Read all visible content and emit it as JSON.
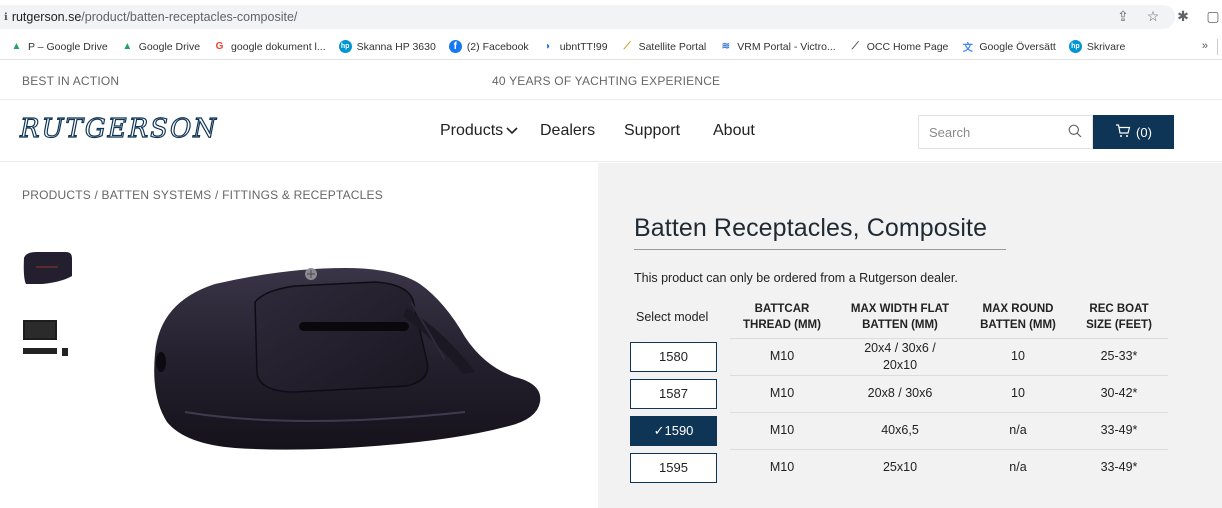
{
  "browser": {
    "url_domain": "rutgerson.se",
    "url_path": "/product/batten-receptacles-composite/",
    "bookmarks": [
      {
        "label": "P – Google Drive",
        "icon": "google-drive-icon",
        "color": "#1fa463"
      },
      {
        "label": "Google Drive",
        "icon": "google-drive-icon",
        "color": "#1fa463"
      },
      {
        "label": "google dokument l...",
        "icon": "google-g-icon",
        "color": "#ea4335"
      },
      {
        "label": "Skanna HP 3630",
        "icon": "hp-icon",
        "color": "#0096d6"
      },
      {
        "label": "(2) Facebook",
        "icon": "facebook-icon",
        "color": "#1877f2"
      },
      {
        "label": "ubntTT!99",
        "icon": "feed-icon",
        "color": "#1a73e8"
      },
      {
        "label": "Satellite Portal",
        "icon": "satellite-icon",
        "color": "#c9a227"
      },
      {
        "label": "VRM Portal - Victro...",
        "icon": "vrm-icon",
        "color": "#3a7bd5"
      },
      {
        "label": "OCC Home Page",
        "icon": "occ-icon",
        "color": "#555555"
      },
      {
        "label": "Google Översätt",
        "icon": "translate-icon",
        "color": "#4285f4"
      },
      {
        "label": "Skrivare",
        "icon": "hp-icon",
        "color": "#0096d6"
      }
    ],
    "bookmarks_more": "»"
  },
  "site": {
    "tagline_left": "BEST IN ACTION",
    "tagline_center": "40 YEARS OF YACHTING EXPERIENCE",
    "logo_text": "RUTGERSON",
    "nav": {
      "products": "Products",
      "dealers": "Dealers",
      "support": "Support",
      "about": "About"
    },
    "search_placeholder": "Search",
    "cart_label": "(0)",
    "brand_color": "#0f3556"
  },
  "breadcrumb": "PRODUCTS / BATTEN SYSTEMS / FITTINGS & RECEPTACLES",
  "product": {
    "title": "Batten Receptacles, Composite",
    "dealer_note": "This product can only be ordered from a Rutgerson dealer.",
    "table": {
      "headers": {
        "select": "Select model",
        "thread_1": "BATTCAR",
        "thread_2": "THREAD (MM)",
        "flat_1": "MAX WIDTH FLAT",
        "flat_2": "BATTEN (MM)",
        "round_1": "MAX ROUND",
        "round_2": "BATTEN (MM)",
        "boat_1": "REC BOAT",
        "boat_2": "SIZE (FEET)"
      },
      "rows": [
        {
          "model": "1580",
          "thread": "M10",
          "flat": "20x4 / 30x6 / 20x10",
          "round": "10",
          "boat": "25-33*"
        },
        {
          "model": "1587",
          "thread": "M10",
          "flat": "20x8 / 30x6",
          "round": "10",
          "boat": "30-42*"
        },
        {
          "model": "✓1590",
          "thread": "M10",
          "flat": "40x6,5",
          "round": "n/a",
          "boat": "33-49*"
        },
        {
          "model": "1595",
          "thread": "M10",
          "flat": "25x10",
          "round": "n/a",
          "boat": "33-49*"
        }
      ]
    }
  }
}
